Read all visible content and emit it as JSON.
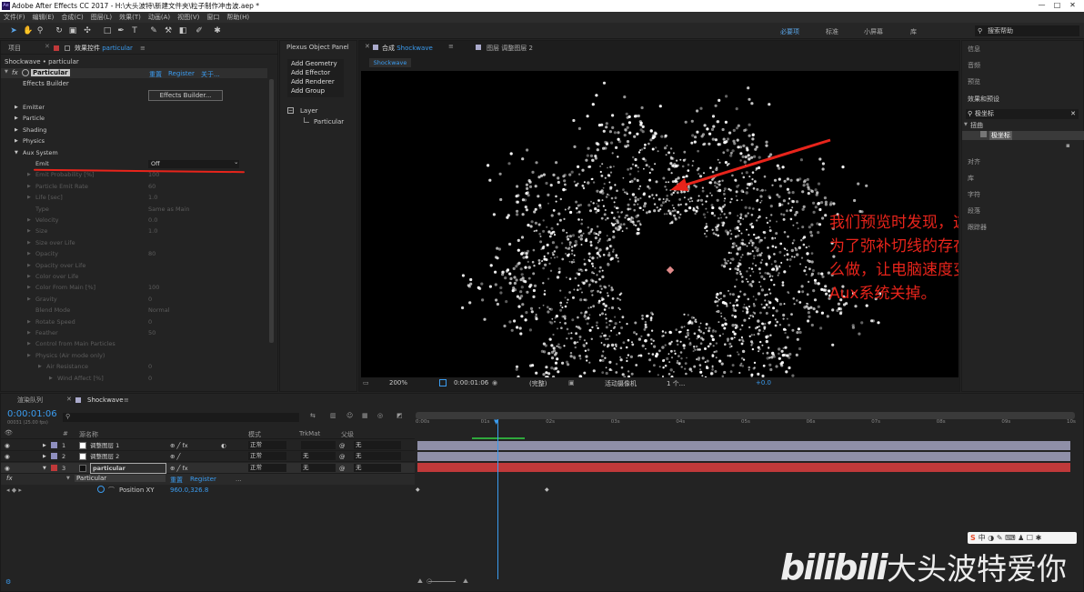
{
  "app": {
    "title": "Adobe After Effects CC 2017 - H:\\大头波特\\新建文件夹\\粒子制作冲击波.aep *",
    "win_min": "—",
    "win_max": "□",
    "win_close": "✕"
  },
  "menu": [
    "文件(F)",
    "编辑(E)",
    "合成(C)",
    "图层(L)",
    "效果(T)",
    "动画(A)",
    "视图(V)",
    "窗口",
    "帮助(H)"
  ],
  "toolbar": {
    "snap_label": "对齐",
    "workspaces": [
      "必要项",
      "标准",
      "小屏幕",
      "库"
    ],
    "search_placeholder": "搜索帮助"
  },
  "project_tab": "项目",
  "effects_tab": {
    "label": "效果控件",
    "layer": "particular"
  },
  "effects": {
    "breadcrumb": "Shockwave • particular",
    "fx_label": "fx",
    "plugin": "Particular",
    "reset": "重置",
    "register": "Register",
    "about": "关于...",
    "builder_label": "Effects Builder",
    "builder_btn": "Effects Builder...",
    "groups": [
      "Emitter",
      "Particle",
      "Shading",
      "Physics",
      "Aux System"
    ],
    "emit_label": "Emit",
    "emit_value": "Off",
    "dim_rows": [
      {
        "label": "Emit Probability [%]",
        "value": "100"
      },
      {
        "label": "Particle Emit Rate",
        "value": "60"
      },
      {
        "label": "Life [sec]",
        "value": "1.0"
      },
      {
        "label": "Type",
        "value": "Same as Main"
      },
      {
        "label": "Velocity",
        "value": "0.0"
      },
      {
        "label": "Size",
        "value": "1.0"
      },
      {
        "label": "Size over Life",
        "value": ""
      },
      {
        "label": "Opacity",
        "value": "80"
      },
      {
        "label": "Opacity over Life",
        "value": ""
      },
      {
        "label": "Color over Life",
        "value": ""
      },
      {
        "label": "Color From Main [%]",
        "value": "100"
      },
      {
        "label": "Gravity",
        "value": "0"
      },
      {
        "label": "Blend Mode",
        "value": "Normal"
      },
      {
        "label": "Rotate Speed",
        "value": "0"
      },
      {
        "label": "Feather",
        "value": "50"
      },
      {
        "label": "Control from Main Particles",
        "value": ""
      },
      {
        "label": "Physics (Air mode only)",
        "value": ""
      },
      {
        "label": "Air Resistance",
        "value": "0"
      },
      {
        "label": "Wind Affect [%]",
        "value": "0"
      },
      {
        "label": "Turbulence Position",
        "value": "0"
      }
    ]
  },
  "plexus": {
    "title": "Plexus Object Panel",
    "items": [
      "Add Geometry",
      "Add Effector",
      "Add Renderer",
      "Add Group"
    ],
    "tree_root": "Layer",
    "tree_child": "Particular"
  },
  "comp": {
    "tab1": "合成",
    "tab1_name": "Shockwave",
    "tab2": "图层",
    "tab2_name": "调整图层 2",
    "subtab": "Shockwave",
    "annotation": "我们预览时发现，这边有个切线，为了弥补切线的存在，我们可以这么做，让电脑速度变快一些，先把Aux系统关掉。",
    "zoom": "200%",
    "timecode": "0:00:01:06",
    "quality": "(完整)",
    "camera": "活动摄像机",
    "views": "1 个...",
    "exposure": "+0.0"
  },
  "right": {
    "items": [
      "信息",
      "音频",
      "预览",
      "效果和预设"
    ],
    "search": "极坐标",
    "folder": "扭曲",
    "effect": "极坐标",
    "more": [
      "对齐",
      "库",
      "字符",
      "段落",
      "跟踪器"
    ]
  },
  "timeline": {
    "render_tab": "渲染队列",
    "comp_tab": "Shockwave",
    "timecode": "0:00:01:06",
    "fps": "00031 (25.00 fps)",
    "col_hash": "#",
    "col_name": "源名称",
    "col_mode": "模式",
    "col_trk": "TrkMat",
    "col_parent": "父级",
    "layers": [
      {
        "num": "1",
        "name": "调整图层 1",
        "mode": "正常",
        "trk": "",
        "parent": "无",
        "color": "#8f8fbf"
      },
      {
        "num": "2",
        "name": "调整图层 2",
        "mode": "正常",
        "trk": "无",
        "parent": "无",
        "color": "#8f8fbf"
      },
      {
        "num": "3",
        "name": "particular",
        "mode": "正常",
        "trk": "无",
        "parent": "无",
        "color": "#c0393a"
      }
    ],
    "sub_fx": "Particular",
    "sub_reset": "重置",
    "sub_register": "Register",
    "sub_more": "...",
    "prop_name": "Position XY",
    "prop_value": "960.0,326.8",
    "ruler": [
      "0:00s",
      "01s",
      "02s",
      "03s",
      "04s",
      "05s",
      "06s",
      "07s",
      "08s",
      "09s",
      "10s"
    ],
    "switch_label": "切换开关/模式"
  },
  "watermark": {
    "logo": "bilibili",
    "text": "大头波特爱你"
  },
  "ime": "中",
  "colors": {
    "accent": "#3b9cf0",
    "red_annot": "#e8241b",
    "bg": "#232323"
  }
}
